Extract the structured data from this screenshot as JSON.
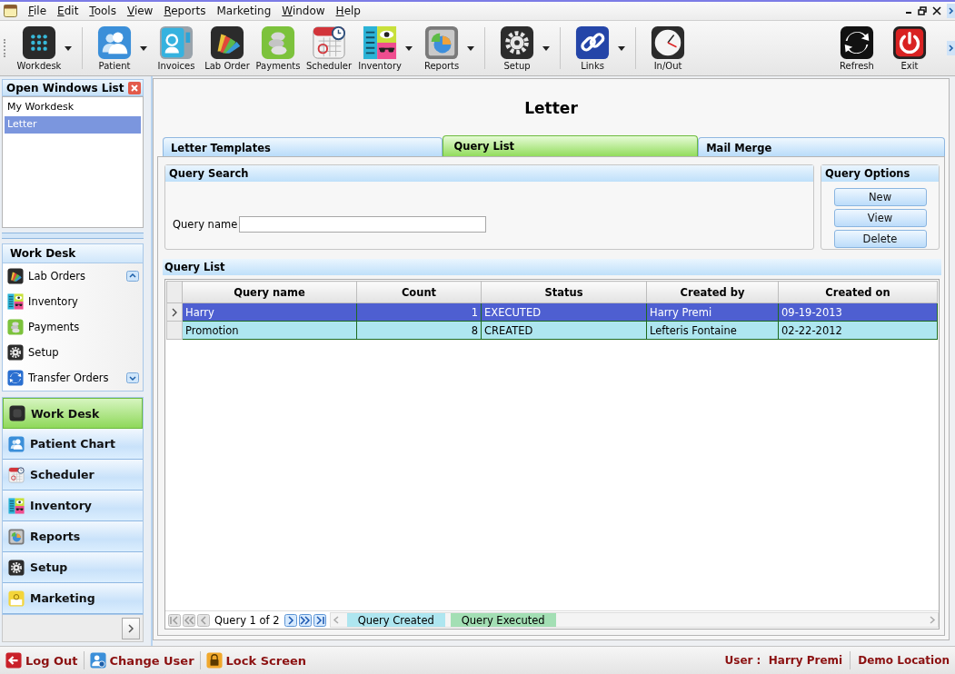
{
  "menu": [
    {
      "label": "File",
      "underline_first": true
    },
    {
      "label": "Edit",
      "underline_first": true
    },
    {
      "label": "Tools",
      "underline_first": true
    },
    {
      "label": "View",
      "underline_first": true
    },
    {
      "label": "Reports",
      "underline_first": true
    },
    {
      "label": "Marketing",
      "underline_first": false
    },
    {
      "label": "Window",
      "underline_first": true
    },
    {
      "label": "Help",
      "underline_first": true
    }
  ],
  "toolbar": {
    "groups": [
      [
        {
          "label": "Workdesk",
          "dropdown": true
        }
      ],
      [
        {
          "label": "Patient",
          "dropdown": true
        },
        {
          "label": "Invoices",
          "dropdown": false
        },
        {
          "label": "Lab Order",
          "dropdown": false
        },
        {
          "label": "Payments",
          "dropdown": false
        },
        {
          "label": "Scheduler",
          "dropdown": false
        },
        {
          "label": "Inventory",
          "dropdown": true
        },
        {
          "label": "Reports",
          "dropdown": true
        }
      ],
      [
        {
          "label": "Setup",
          "dropdown": true
        }
      ],
      [
        {
          "label": "Links",
          "dropdown": true
        }
      ],
      [
        {
          "label": "In/Out",
          "dropdown": false
        }
      ]
    ],
    "right_items": [
      {
        "label": "Refresh"
      },
      {
        "label": "Exit"
      }
    ]
  },
  "open_windows": {
    "title": "Open Windows List",
    "items": [
      {
        "label": "My Workdesk",
        "selected": false
      },
      {
        "label": "Letter",
        "selected": true
      }
    ]
  },
  "work_desk_panel": {
    "title": "Work Desk",
    "items": [
      {
        "label": "Lab Orders"
      },
      {
        "label": "Inventory"
      },
      {
        "label": "Payments"
      },
      {
        "label": "Setup"
      },
      {
        "label": "Transfer Orders"
      }
    ]
  },
  "navigation": [
    {
      "label": "Work Desk",
      "selected": true
    },
    {
      "label": "Patient Chart",
      "selected": false
    },
    {
      "label": "Scheduler",
      "selected": false
    },
    {
      "label": "Inventory",
      "selected": false
    },
    {
      "label": "Reports",
      "selected": false
    },
    {
      "label": "Setup",
      "selected": false
    },
    {
      "label": "Marketing",
      "selected": false
    }
  ],
  "page": {
    "title": "Letter",
    "tabs": [
      {
        "label": "Letter Templates",
        "selected": false
      },
      {
        "label": "Query  List",
        "selected": true
      },
      {
        "label": "Mail Merge",
        "selected": false
      }
    ],
    "query_search": {
      "title": "Query Search",
      "field_label": "Query name"
    },
    "query_options": {
      "title": "Query Options",
      "buttons": [
        "New",
        "View",
        "Delete"
      ]
    },
    "query_list": {
      "title": "Query List",
      "columns": [
        "Query name",
        "Count",
        "Status",
        "Created by",
        "Created on"
      ],
      "rows": [
        {
          "cells": [
            "Harry",
            "1",
            "EXECUTED",
            "Harry Premi",
            "09-19-2013"
          ],
          "selected": true,
          "color": "#4e5fd1"
        },
        {
          "cells": [
            "Promotion",
            "8",
            "CREATED",
            "Lefteris Fontaine",
            "02-22-2012"
          ],
          "selected": false,
          "color": "#aee6f0"
        }
      ],
      "pager": {
        "text": "Query 1 of 2",
        "back_disabled": true,
        "forward_disabled": false
      },
      "legend": [
        {
          "label": "Query Created",
          "color": "#aee6f0"
        },
        {
          "label": "Query Executed",
          "color": "#a3dfb4"
        }
      ]
    }
  },
  "status_bar": {
    "actions": [
      {
        "label": "Log Out"
      },
      {
        "label": "Change User"
      },
      {
        "label": "Lock Screen"
      }
    ],
    "user": "User :  Harry Premi",
    "location": "Demo Location"
  }
}
